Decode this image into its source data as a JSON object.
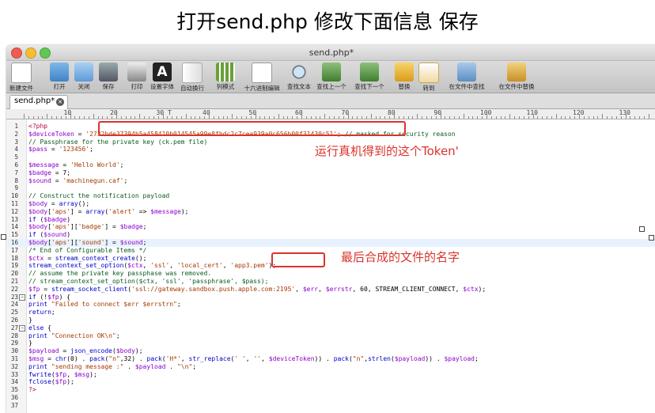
{
  "heading": "打开send.php 修改下面信息 保存",
  "window": {
    "title": "send.php*"
  },
  "toolbar": [
    {
      "label": "新建文件",
      "icon": "new-file-icon"
    },
    {
      "label": "打开",
      "icon": "open-folder-icon"
    },
    {
      "label": "关闭",
      "icon": "close-folder-icon"
    },
    {
      "label": "保存",
      "icon": "save-icon"
    },
    {
      "label": "打印",
      "icon": "print-icon"
    },
    {
      "label": "设置字体",
      "icon": "font-icon"
    },
    {
      "label": "自动换行",
      "icon": "word-wrap-icon"
    },
    {
      "label": "列模式",
      "icon": "column-mode-icon"
    },
    {
      "label": "十六进制编辑",
      "icon": "hex-edit-icon"
    },
    {
      "label": "查找文本",
      "icon": "find-text-icon"
    },
    {
      "label": "查找上一个",
      "icon": "find-previous-icon"
    },
    {
      "label": "查找下一个",
      "icon": "find-next-icon"
    },
    {
      "label": "替换",
      "icon": "replace-icon"
    },
    {
      "label": "转到",
      "icon": "goto-icon"
    },
    {
      "label": "在文件中查找",
      "icon": "find-in-files-icon"
    },
    {
      "label": "在文件中替换",
      "icon": "replace-in-files-icon"
    }
  ],
  "tab": {
    "name": "send.php*",
    "close_glyph": "×"
  },
  "ruler": [
    "10",
    "20",
    "30 T",
    "40",
    "50",
    "60",
    "70",
    "80",
    "90",
    "100",
    "110",
    "120",
    "130"
  ],
  "lines": [
    {
      "num": "1",
      "text": "<?php"
    },
    {
      "num": "2",
      "text": "$deviceToken = '2732bde37394b5a458410b014545a99e8fbdc2c7cea939a0c656b00f31430c51'; // masked for security reason"
    },
    {
      "num": "3",
      "text": "// Passphrase for the private key (ck.pem file)"
    },
    {
      "num": "4",
      "text": "$pass = '123456';"
    },
    {
      "num": "5",
      "text": ""
    },
    {
      "num": "6",
      "text": "$message = 'Hello World';"
    },
    {
      "num": "7",
      "text": "$badge = 7;"
    },
    {
      "num": "8",
      "text": "$sound = 'machinegun.caf';"
    },
    {
      "num": "9",
      "text": ""
    },
    {
      "num": "10",
      "text": "// Construct the notification payload"
    },
    {
      "num": "11",
      "text": "$body = array();"
    },
    {
      "num": "12",
      "text": "$body['aps'] = array('alert' => $message);"
    },
    {
      "num": "13",
      "text": "if ($badge)"
    },
    {
      "num": "14",
      "text": "$body['aps']['badge'] = $badge;"
    },
    {
      "num": "15",
      "text": "if ($sound)"
    },
    {
      "num": "16",
      "text": "$body['aps']['sound'] = $sound;"
    },
    {
      "num": "17",
      "text": "/* End of Configurable Items */"
    },
    {
      "num": "18",
      "text": "$ctx = stream_context_create();"
    },
    {
      "num": "19",
      "text": "stream_context_set_option($ctx, 'ssl', 'local_cert', 'app3.pem');"
    },
    {
      "num": "20",
      "text": "// assume the private key passphase was removed."
    },
    {
      "num": "21",
      "text": "// stream_context_set_option($ctx, 'ssl', 'passphrase', $pass);"
    },
    {
      "num": "22",
      "text": "$fp = stream_socket_client('ssl://gateway.sandbox.push.apple.com:2195', $err, $errstr, 60, STREAM_CLIENT_CONNECT, $ctx);"
    },
    {
      "num": "23",
      "text": "if (!$fp) {",
      "fold": "−"
    },
    {
      "num": "24",
      "text": "print \"Failed to connect $err $errstrn\";"
    },
    {
      "num": "25",
      "text": "return;"
    },
    {
      "num": "26",
      "text": "}"
    },
    {
      "num": "27",
      "text": "else {",
      "fold": "−"
    },
    {
      "num": "28",
      "text": "print \"Connection OK\\n\";"
    },
    {
      "num": "29",
      "text": "}"
    },
    {
      "num": "30",
      "text": "$payload = json_encode($body);"
    },
    {
      "num": "31",
      "text": "$msg = chr(0) . pack(\"n\",32) . pack('H*', str_replace(' ', '', $deviceToken)) . pack(\"n\",strlen($payload)) . $payload;"
    },
    {
      "num": "32",
      "text": "print \"sending message :\" . $payload . \"\\n\";"
    },
    {
      "num": "33",
      "text": "fwrite($fp, $msg);"
    },
    {
      "num": "34",
      "text": "fclose($fp);"
    },
    {
      "num": "35",
      "text": "?>"
    },
    {
      "num": "36",
      "text": ""
    },
    {
      "num": "37",
      "text": ""
    }
  ],
  "annotations": {
    "token_note": "运行真机得到的这个Token'",
    "pem_note": "最后合成的文件的名字"
  },
  "colors": {
    "annotation": "#d9342b",
    "comment": "#0b5b1f",
    "variable": "#8b00c9",
    "keyword": "#0000cc",
    "string": "#a33a00",
    "php_tag": "#b8004a"
  }
}
